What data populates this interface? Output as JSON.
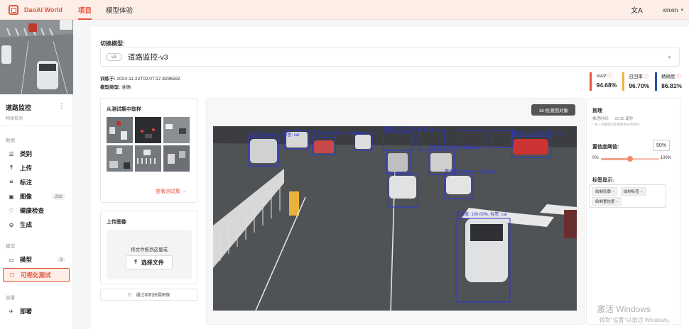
{
  "app": {
    "name": "DaoAI World"
  },
  "nav": {
    "tabs": [
      "项目",
      "模型体验"
    ],
    "active": 0
  },
  "header": {
    "lang_icon": "文A",
    "user": "xinxin"
  },
  "sidebar": {
    "project_title": "道路监控",
    "project_subtitle": "物体检测",
    "sections": {
      "data": "数据",
      "model": "模型",
      "deploy": "部署"
    },
    "items": [
      {
        "icon": "list-icon",
        "glyph": "☰",
        "label": "类别"
      },
      {
        "icon": "upload-icon",
        "glyph": "⤒",
        "label": "上传"
      },
      {
        "icon": "annotate-icon",
        "glyph": "⌗",
        "label": "标注"
      },
      {
        "icon": "image-icon",
        "glyph": "▣",
        "label": "图像",
        "count": "202"
      },
      {
        "icon": "health-icon",
        "glyph": "♡",
        "label": "健康检查"
      },
      {
        "icon": "generate-icon",
        "glyph": "⊝",
        "label": "生成"
      }
    ],
    "model_items": [
      {
        "icon": "folder-icon",
        "glyph": "▭",
        "label": "模型",
        "count": "3"
      },
      {
        "icon": "test-icon",
        "glyph": "☐",
        "label": "可视化测试",
        "active": true
      }
    ],
    "deploy_items": [
      {
        "icon": "deploy-icon",
        "glyph": "✈",
        "label": "部署"
      }
    ]
  },
  "main": {
    "switch_label": "切换模型:",
    "version_tag": "v3",
    "model_name": "道路监控-v3",
    "train_label": "训练于:",
    "train_time": "2024-11-22T02:07:17.829659Z",
    "model_type_label": "模型类型:",
    "model_type": "准确",
    "metrics": [
      {
        "label": "mAP",
        "value": "94.68%",
        "color": "#e2553a"
      },
      {
        "label": "召回率",
        "value": "96.70%",
        "color": "#f0b33c"
      },
      {
        "label": "精确度",
        "value": "86.81%",
        "color": "#2a4fa8"
      }
    ],
    "sample_card_title": "从测试集中取样",
    "view_testset": "查看测试集 →",
    "upload_card_title": "上传图像",
    "drop_text": "将文件拖到这里或",
    "choose_file": "选择文件",
    "camera_text": "通过相机拍摄图像",
    "detect_badge": "18 检测到对象",
    "box_label": "置信度: 100.00%, 标签: car"
  },
  "panel": {
    "inference_title": "推理",
    "inference_time_label": "推理时间:",
    "inference_time": "22.36 毫秒",
    "inference_note": "* 第一次推理可能需要更长的时间",
    "threshold_title": "置信度阈值:",
    "threshold_value": "50%",
    "threshold_fraction": 0.5,
    "min_label": "0%",
    "max_label": "100%",
    "tags_title": "标签显示:",
    "tags": [
      "绘制轮廓",
      "绘制标签",
      "绘制置信度"
    ]
  },
  "watermark": {
    "line1": "激活 Windows",
    "line2": "转到\"设置\"以激活 Windows。"
  }
}
